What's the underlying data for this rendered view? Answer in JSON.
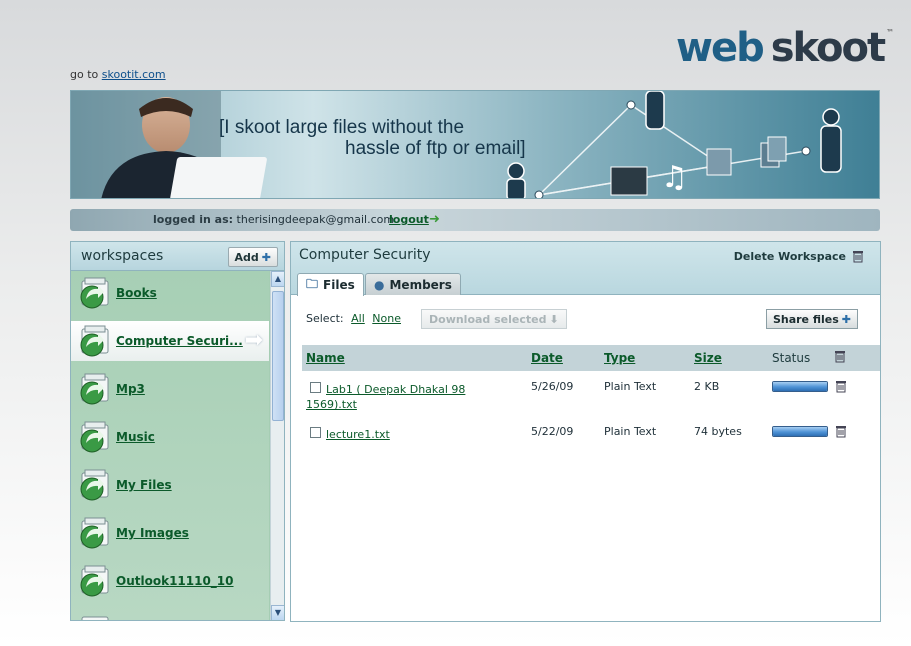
{
  "header": {
    "logo_part1": "web",
    "logo_part2": "skoot",
    "logo_tm": "™",
    "goto_prefix": "go to",
    "goto_link": "skootit.com"
  },
  "banner": {
    "line1": "[I skoot large files without the",
    "line2": "hassle of ftp or email]"
  },
  "login": {
    "label": "logged in as:",
    "user": "therisingdeepak@gmail.com",
    "logout": "logout"
  },
  "workspaces": {
    "title": "workspaces",
    "add_label": "Add",
    "items": [
      {
        "label": "Books"
      },
      {
        "label": "Computer Securi..."
      },
      {
        "label": "Mp3"
      },
      {
        "label": "Music"
      },
      {
        "label": "My Files"
      },
      {
        "label": "My Images"
      },
      {
        "label": "Outlook11110_10"
      }
    ],
    "active_index": 1
  },
  "main": {
    "workspace_name": "Computer Security",
    "delete_label": "Delete Workspace",
    "tabs": [
      {
        "label": "Files"
      },
      {
        "label": "Members"
      }
    ],
    "select_label": "Select:",
    "select_all": "All",
    "select_none": "None",
    "download_label": "Download selected",
    "share_label": "Share files",
    "columns": {
      "name": "Name",
      "date": "Date",
      "type": "Type",
      "size": "Size",
      "status": "Status"
    },
    "files": [
      {
        "name": "Lab1 ( Deepak Dhakal 98 1569).txt",
        "date": "5/26/09",
        "type": "Plain Text",
        "size": "2 KB",
        "progress": 1.0
      },
      {
        "name": "lecture1.txt",
        "date": "5/22/09",
        "type": "Plain Text",
        "size": "74 bytes",
        "progress": 1.0
      }
    ]
  },
  "colors": {
    "link_green": "#0b5a2a",
    "panel_teal": "#b9d7df",
    "sidebar_green": "#a7cfb5",
    "progress_blue": "#4f93d6"
  }
}
